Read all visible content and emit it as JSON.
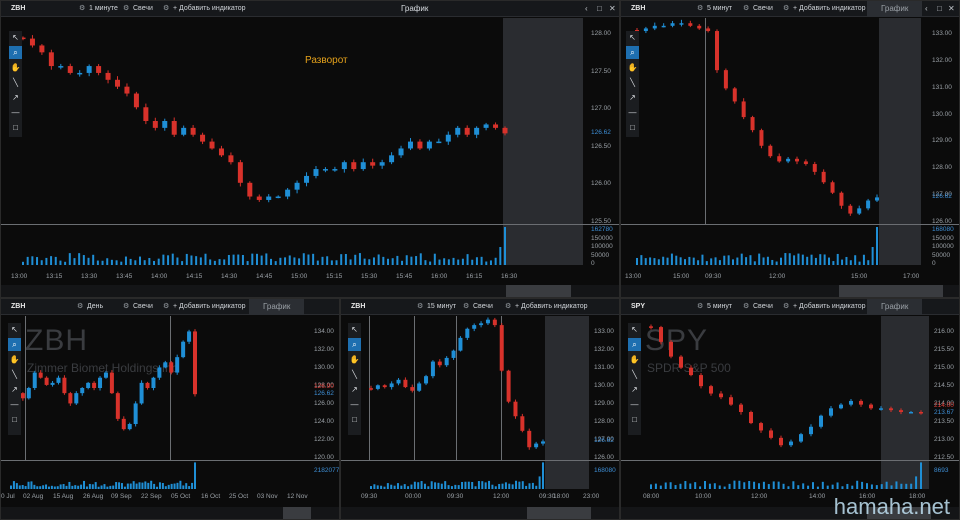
{
  "panels": [
    {
      "id": "p1",
      "symbol": "ZBH",
      "interval": "1 минуте",
      "chart_type": "Свечи",
      "add_indicator": "+ Добавить индикатор",
      "title": "График",
      "annotation": "Разворот",
      "last_price": "126.62",
      "last_volume": "162780",
      "y_labels": [
        "128.00",
        "127.50",
        "127.00",
        "126.50",
        "126.00",
        "125.50"
      ],
      "vol_labels": [
        "162780",
        "150000",
        "100000",
        "50000",
        "0"
      ],
      "x_labels": [
        "13:00",
        "13:15",
        "13:30",
        "13:45",
        "14:00",
        "14:15",
        "14:30",
        "14:45",
        "15:00",
        "15:15",
        "15:30",
        "15:45",
        "16:00",
        "16:15",
        "16:30"
      ]
    },
    {
      "id": "p2",
      "symbol": "ZBH",
      "interval": "5 минут",
      "chart_type": "Свечи",
      "add_indicator": "+ Добавить индикатор",
      "title": "График",
      "last_price": "126.62",
      "last_volume": "168080",
      "y_labels": [
        "133.00",
        "132.00",
        "131.00",
        "130.00",
        "129.00",
        "128.00",
        "127.00",
        "126.00"
      ],
      "vol_labels": [
        "168080",
        "150000",
        "100000",
        "50000",
        "0"
      ],
      "x_labels": [
        "13:00",
        "15:00",
        "09:30",
        "12:00",
        "15:00",
        "17:00"
      ]
    },
    {
      "id": "p3",
      "symbol": "ZBH",
      "interval": "День",
      "chart_type": "Свечи",
      "add_indicator": "+ Добавить индикатор",
      "title": "График",
      "watermark_symbol": "ZBH",
      "watermark_name": "Zimmer Biomet Holdings Inc",
      "last_price": "126.62",
      "last_volume": "2182077",
      "y_labels": [
        "134.00",
        "132.00",
        "130.00",
        "128.00",
        "126.00",
        "124.00",
        "122.00",
        "120.00"
      ],
      "red_label": "126.90",
      "x_labels": [
        "0 Jul",
        "02 Aug",
        "15 Aug",
        "26 Aug",
        "09 Sep",
        "22 Sep",
        "05 Oct",
        "16 Oct",
        "25 Oct",
        "03 Nov",
        "12 Nov"
      ]
    },
    {
      "id": "p4",
      "symbol": "ZBH",
      "interval": "15 минут",
      "chart_type": "Свечи",
      "add_indicator": "+ Добавить индикатор",
      "title": "График",
      "last_price": "126.62",
      "last_volume": "168080",
      "y_labels": [
        "133.00",
        "132.00",
        "131.00",
        "130.00",
        "129.00",
        "128.00",
        "127.00",
        "126.00"
      ],
      "x_labels": [
        "09:30",
        "00:00",
        "09:30",
        "12:00",
        "09:30",
        "18:00",
        "23:00"
      ]
    },
    {
      "id": "p5",
      "symbol": "SPY",
      "interval": "5 минут",
      "chart_type": "Свечи",
      "add_indicator": "+ Добавить индикатор",
      "title": "График",
      "watermark_symbol": "SPY",
      "watermark_name": "SPDR S&P 500",
      "last_price": "213.67",
      "last_volume": "8693",
      "y_labels": [
        "216.00",
        "215.50",
        "215.00",
        "214.50",
        "214.00",
        "213.50",
        "213.00",
        "212.50"
      ],
      "red_label": "214.00",
      "x_labels": [
        "08:00",
        "10:00",
        "12:00",
        "14:00",
        "16:00",
        "18:00"
      ]
    }
  ],
  "tools": [
    "cursor",
    "zoom",
    "hand",
    "line",
    "arrow",
    "hline",
    "rect"
  ],
  "site_watermark": "hamaha.net",
  "colors": {
    "up": "#1f8fd6",
    "down": "#d8322b",
    "background": "#0b0b0b",
    "shade": "#2a2c30",
    "annotation": "#e4a11b"
  },
  "chart_data": [
    {
      "type": "candlestick",
      "title": "ZBH 1 минуте",
      "ylim": [
        125.3,
        128.3
      ],
      "close": [
        128.0,
        127.9,
        127.8,
        127.6,
        127.6,
        127.5,
        127.5,
        127.6,
        127.5,
        127.4,
        127.3,
        127.2,
        127.0,
        126.8,
        126.7,
        126.8,
        126.6,
        126.7,
        126.6,
        126.5,
        126.4,
        126.3,
        126.2,
        125.9,
        125.7,
        125.65,
        125.7,
        125.7,
        125.8,
        125.9,
        126.0,
        126.1,
        126.1,
        126.1,
        126.2,
        126.1,
        126.2,
        126.15,
        126.2,
        126.3,
        126.4,
        126.5,
        126.4,
        126.5,
        126.5,
        126.6,
        126.7,
        126.6,
        126.7,
        126.75,
        126.7,
        126.62
      ]
    },
    {
      "type": "candlestick",
      "title": "ZBH 5 минут",
      "ylim": [
        125.6,
        133.5
      ],
      "close": [
        133.0,
        133.1,
        133.2,
        133.2,
        133.3,
        133.3,
        133.2,
        133.1,
        133.0,
        131.5,
        130.8,
        130.3,
        129.7,
        129.2,
        128.6,
        128.2,
        128.0,
        128.1,
        128.0,
        127.9,
        127.6,
        127.2,
        126.8,
        126.3,
        126.0,
        126.2,
        126.5,
        126.62
      ]
    },
    {
      "type": "candlestick",
      "title": "ZBH День",
      "ylim": [
        120.5,
        134.5
      ],
      "close": [
        128,
        127,
        126.5,
        127.5,
        129,
        128.5,
        127.8,
        128,
        128.5,
        127,
        126,
        127,
        127.5,
        128,
        127.5,
        128.5,
        129,
        127,
        124.5,
        123.5,
        124,
        126,
        128,
        127.5,
        128.5,
        129.5,
        130,
        129,
        130.5,
        132,
        133,
        126.9
      ]
    },
    {
      "type": "candlestick",
      "title": "ZBH 15 минут",
      "ylim": [
        125.6,
        133.5
      ],
      "close": [
        129.5,
        129.7,
        129.6,
        129.8,
        130.0,
        129.6,
        129.4,
        129.8,
        130.2,
        131.0,
        130.8,
        131.2,
        131.6,
        132.3,
        132.8,
        133.0,
        133.1,
        133.3,
        133.0,
        130.5,
        128.8,
        128.0,
        127.2,
        126.3,
        126.5,
        126.62
      ]
    },
    {
      "type": "candlestick",
      "title": "SPY 5 минут",
      "ylim": [
        212.4,
        216.3
      ],
      "close": [
        216.0,
        215.6,
        215.2,
        214.9,
        214.7,
        214.4,
        214.2,
        214.1,
        213.9,
        213.7,
        213.4,
        213.2,
        213.0,
        212.8,
        212.9,
        213.1,
        213.3,
        213.6,
        213.8,
        213.9,
        214.0,
        213.9,
        213.8,
        213.8,
        213.75,
        213.7,
        213.7,
        213.67
      ]
    }
  ]
}
